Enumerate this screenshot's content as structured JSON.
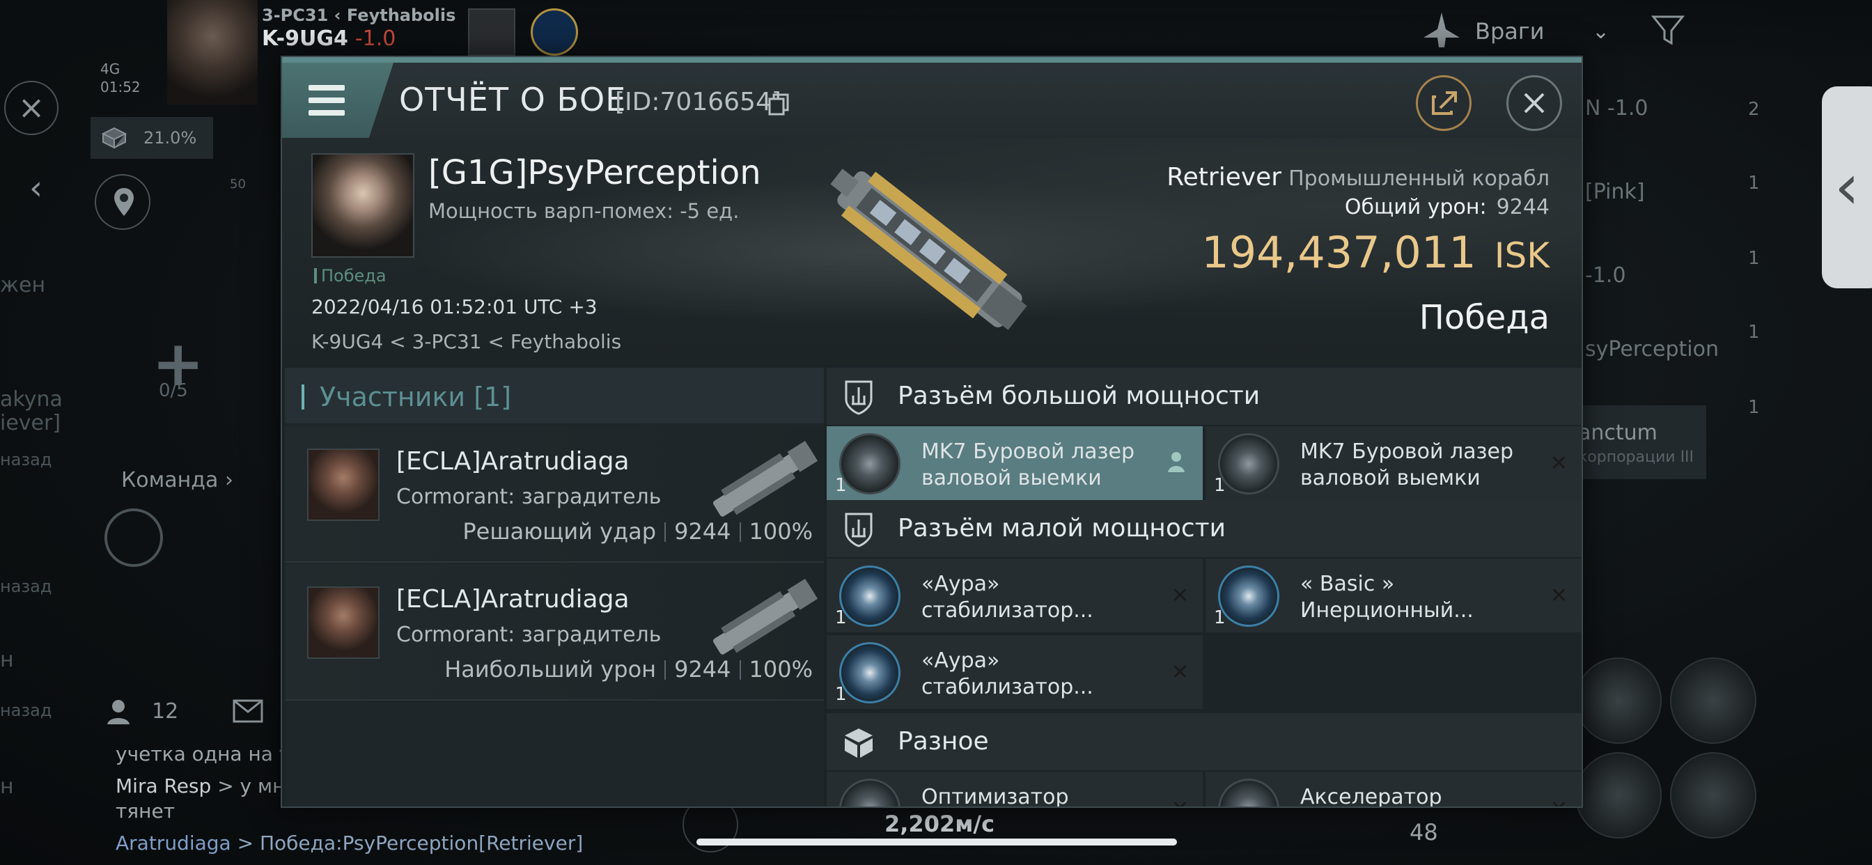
{
  "hud": {
    "system_sec_prefix": "3-PC31",
    "region": "Feythabolis",
    "system_name": "K-9UG4",
    "system_sec": "-1.0",
    "battery_label": "4G",
    "clock": "01:52",
    "cargo_percent": "21.0%",
    "range_label": "50",
    "slots_count": "0/5",
    "team_label": "Команда",
    "filter_label": "Враги",
    "speed": "2,202м/с",
    "chat_count": "12",
    "chat_lines": [
      {
        "speaker": "",
        "text": "учетка одна на тр"
      },
      {
        "speaker": "Mira Resp",
        "text": " > у мну"
      },
      {
        "speaker": "",
        "text": "тянет"
      },
      {
        "speaker": "Aratrudiaga",
        "text": " > Победа:PsyPerception[Retriever]"
      }
    ],
    "left_fragments": [
      "жен",
      "akyna",
      "iever]",
      "назад",
      "назад",
      "назад",
      "н",
      "н"
    ],
    "right_items": [
      {
        "text": "N -1.0",
        "count": "2"
      },
      {
        "text": "[Pink]",
        "count": "1"
      },
      {
        "text": "-1.0",
        "count": "1"
      },
      {
        "text": "syPerception",
        "count": "1"
      },
      {
        "text": "anctum",
        "count": "1"
      }
    ],
    "right_sub": "корпорации III",
    "num_48": "48",
    "drawer_glyph": "‹"
  },
  "window": {
    "title": "ОТЧЁТ О БОЕ",
    "id": "[ID:7016654]"
  },
  "victim": {
    "name": "[G1G]PsyPerception",
    "warp_line": "Мощность варп-помех: -5 ед.",
    "victory_tag": "Победа",
    "datetime": "2022/04/16 01:52:01 UTC +3",
    "route": "K-9UG4 < 3-PC31 < Feythabolis",
    "ship": "Retriever",
    "ship_class": "Промышленный корабл",
    "total_damage_label": "Общий урон:",
    "total_damage": "9244",
    "isk_value": "194,437,011",
    "isk_unit": "ISK",
    "result": "Победа"
  },
  "participants": {
    "title": "Участники [1]",
    "list": [
      {
        "name": "[ECLA]Aratrudiaga",
        "ship": "Cormorant: заградитель",
        "role": "Решающий удар",
        "damage": "9244",
        "percent": "100%"
      },
      {
        "name": "[ECLA]Aratrudiaga",
        "ship": "Cormorant: заградитель",
        "role": "Наибольший урон",
        "damage": "9244",
        "percent": "100%"
      }
    ]
  },
  "fitting": {
    "high_title": "Разъём большой мощности",
    "low_title": "Разъём малой мощности",
    "misc_title": "Разное",
    "high": [
      {
        "line1": "MK7 Буровой лазер",
        "line2": "валовой выемки",
        "qty": "1"
      },
      {
        "line1": "MK7 Буровой лазер",
        "line2": "валовой выемки",
        "qty": "1"
      }
    ],
    "low": [
      {
        "line1": "«Аура»",
        "line2": "стабилизатор...",
        "qty": "1"
      },
      {
        "line1": "« Basic »",
        "line2": "Инерционный...",
        "qty": "1"
      },
      {
        "line1": "«Аура»",
        "line2": "стабилизатор...",
        "qty": "1"
      }
    ],
    "misc": [
      {
        "line1": "Оптимизатор"
      },
      {
        "line1": "Акселератор"
      }
    ],
    "x_glyph": "✕"
  }
}
